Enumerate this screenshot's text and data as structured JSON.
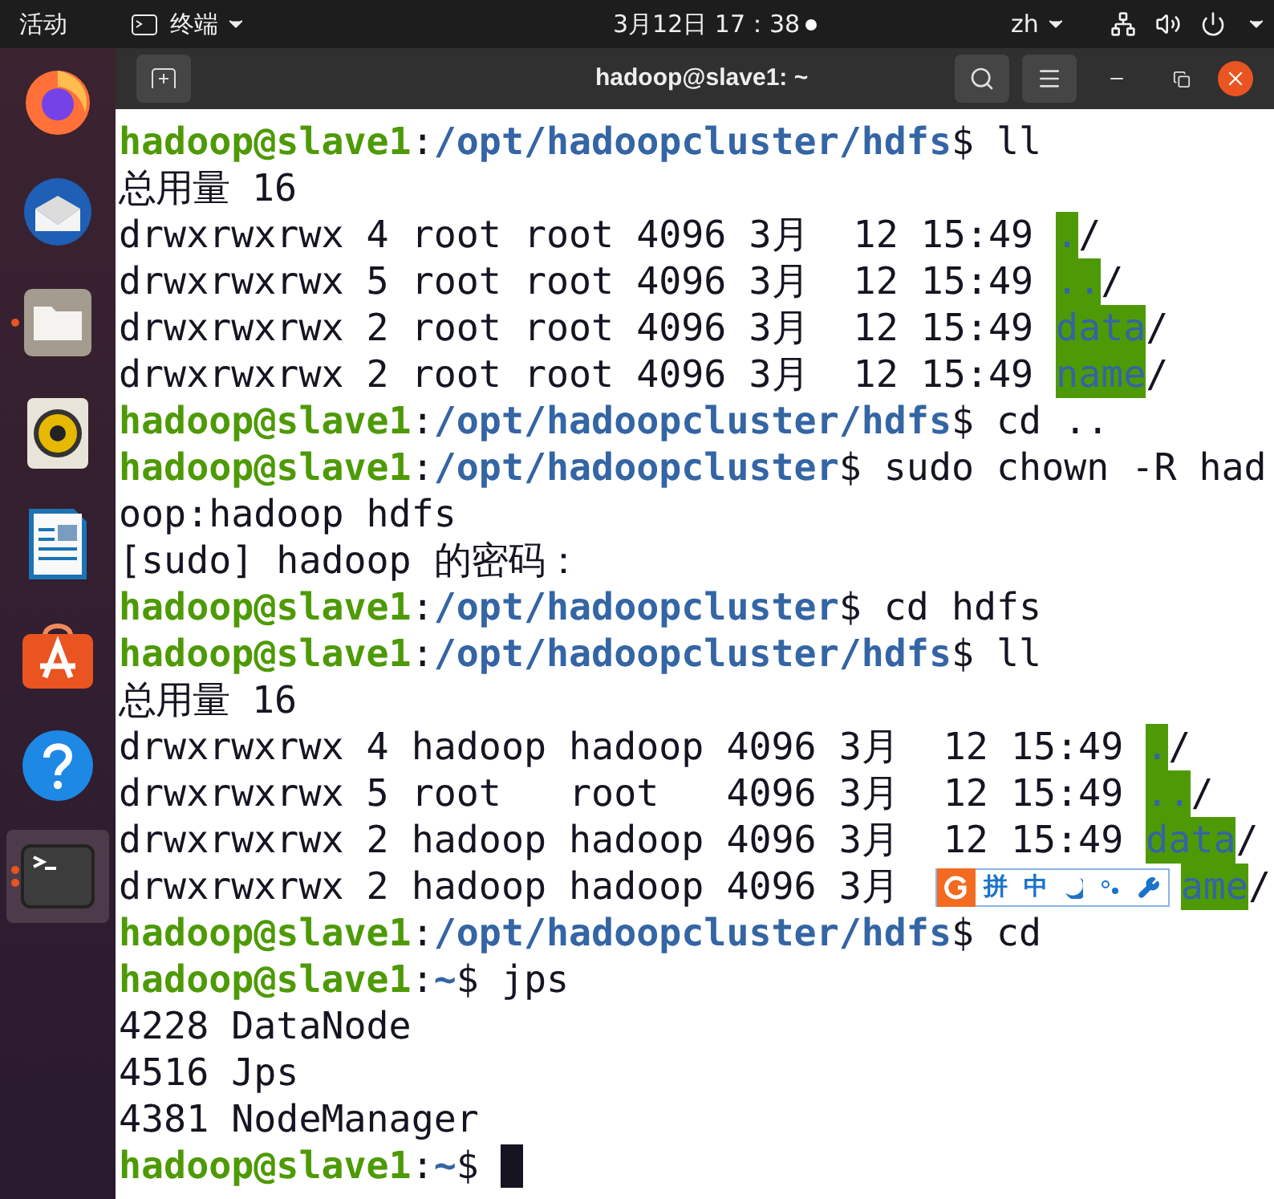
{
  "top_bar": {
    "activities": "活动",
    "app_menu": "终端",
    "clock": "3月12日 17：38",
    "input_method": "zh"
  },
  "dock": [
    {
      "kind": "firefox",
      "running": false,
      "multiple_windows": false,
      "selected": false
    },
    {
      "kind": "thunderbird",
      "running": false,
      "multiple_windows": false,
      "selected": false
    },
    {
      "kind": "files",
      "running": true,
      "multiple_windows": false,
      "selected": false
    },
    {
      "kind": "rhythmbox",
      "running": false,
      "multiple_windows": false,
      "selected": false
    },
    {
      "kind": "writer",
      "running": false,
      "multiple_windows": false,
      "selected": false
    },
    {
      "kind": "software",
      "running": false,
      "multiple_windows": false,
      "selected": false
    },
    {
      "kind": "help",
      "running": false,
      "multiple_windows": false,
      "selected": false
    },
    {
      "kind": "terminal",
      "running": true,
      "multiple_windows": true,
      "selected": true
    }
  ],
  "window": {
    "title": "hadoop@slave1: ~"
  },
  "terminal": {
    "lines": [
      [
        {
          "kind": "user",
          "text": "hadoop@slave1"
        },
        {
          "kind": "plain",
          "text": ":"
        },
        {
          "kind": "path",
          "text": "/opt/hadoopcluster/hdfs"
        },
        {
          "kind": "plain",
          "text": "$ ll"
        }
      ],
      [
        {
          "kind": "plain",
          "text": "总用量 16"
        }
      ],
      [
        {
          "kind": "plain",
          "text": "drwxrwxrwx 4 root root 4096 3月  12 15:49 "
        },
        {
          "kind": "dir",
          "text": "."
        },
        {
          "kind": "plain",
          "text": "/"
        }
      ],
      [
        {
          "kind": "plain",
          "text": "drwxrwxrwx 5 root root 4096 3月  12 15:49 "
        },
        {
          "kind": "dir",
          "text": ".."
        },
        {
          "kind": "plain",
          "text": "/"
        }
      ],
      [
        {
          "kind": "plain",
          "text": "drwxrwxrwx 2 root root 4096 3月  12 15:49 "
        },
        {
          "kind": "dir",
          "text": "data"
        },
        {
          "kind": "plain",
          "text": "/"
        }
      ],
      [
        {
          "kind": "plain",
          "text": "drwxrwxrwx 2 root root 4096 3月  12 15:49 "
        },
        {
          "kind": "dir",
          "text": "name"
        },
        {
          "kind": "plain",
          "text": "/"
        }
      ],
      [
        {
          "kind": "user",
          "text": "hadoop@slave1"
        },
        {
          "kind": "plain",
          "text": ":"
        },
        {
          "kind": "path",
          "text": "/opt/hadoopcluster/hdfs"
        },
        {
          "kind": "plain",
          "text": "$ cd .."
        }
      ],
      [
        {
          "kind": "user",
          "text": "hadoop@slave1"
        },
        {
          "kind": "plain",
          "text": ":"
        },
        {
          "kind": "path",
          "text": "/opt/hadoopcluster"
        },
        {
          "kind": "plain",
          "text": "$ sudo chown -R had"
        }
      ],
      [
        {
          "kind": "plain",
          "text": "oop:hadoop hdfs"
        }
      ],
      [
        {
          "kind": "plain",
          "text": "[sudo] hadoop 的密码："
        }
      ],
      [
        {
          "kind": "user",
          "text": "hadoop@slave1"
        },
        {
          "kind": "plain",
          "text": ":"
        },
        {
          "kind": "path",
          "text": "/opt/hadoopcluster"
        },
        {
          "kind": "plain",
          "text": "$ cd hdfs"
        }
      ],
      [
        {
          "kind": "user",
          "text": "hadoop@slave1"
        },
        {
          "kind": "plain",
          "text": ":"
        },
        {
          "kind": "path",
          "text": "/opt/hadoopcluster/hdfs"
        },
        {
          "kind": "plain",
          "text": "$ ll"
        }
      ],
      [
        {
          "kind": "plain",
          "text": "总用量 16"
        }
      ],
      [
        {
          "kind": "plain",
          "text": "drwxrwxrwx 4 hadoop hadoop 4096 3月  12 15:49 "
        },
        {
          "kind": "dir",
          "text": "."
        },
        {
          "kind": "plain",
          "text": "/"
        }
      ],
      [
        {
          "kind": "plain",
          "text": "drwxrwxrwx 5 root   root   4096 3月  12 15:49 "
        },
        {
          "kind": "dir",
          "text": ".."
        },
        {
          "kind": "plain",
          "text": "/"
        }
      ],
      [
        {
          "kind": "plain",
          "text": "drwxrwxrwx 2 hadoop hadoop 4096 3月  12 15:49 "
        },
        {
          "kind": "dir",
          "text": "data"
        },
        {
          "kind": "plain",
          "text": "/"
        }
      ],
      [
        {
          "kind": "plain",
          "text": "drwxrwxrwx 2 hadoop hadoop 4096 3月"
        },
        {
          "kind": "ime",
          "items": [
            "拼",
            "中"
          ]
        },
        {
          "kind": "dir",
          "text": "ame"
        },
        {
          "kind": "plain",
          "text": "/"
        }
      ],
      [
        {
          "kind": "user",
          "text": "hadoop@slave1"
        },
        {
          "kind": "plain",
          "text": ":"
        },
        {
          "kind": "path",
          "text": "/opt/hadoopcluster/hdfs"
        },
        {
          "kind": "plain",
          "text": "$ cd"
        }
      ],
      [
        {
          "kind": "user",
          "text": "hadoop@slave1"
        },
        {
          "kind": "plain",
          "text": ":"
        },
        {
          "kind": "path",
          "text": "~"
        },
        {
          "kind": "plain",
          "text": "$ jps"
        }
      ],
      [
        {
          "kind": "plain",
          "text": "4228 DataNode"
        }
      ],
      [
        {
          "kind": "plain",
          "text": "4516 Jps"
        }
      ],
      [
        {
          "kind": "plain",
          "text": "4381 NodeManager"
        }
      ],
      [
        {
          "kind": "user",
          "text": "hadoop@slave1"
        },
        {
          "kind": "plain",
          "text": ":"
        },
        {
          "kind": "path",
          "text": "~"
        },
        {
          "kind": "plain",
          "text": "$ "
        },
        {
          "kind": "cursor"
        }
      ]
    ]
  }
}
